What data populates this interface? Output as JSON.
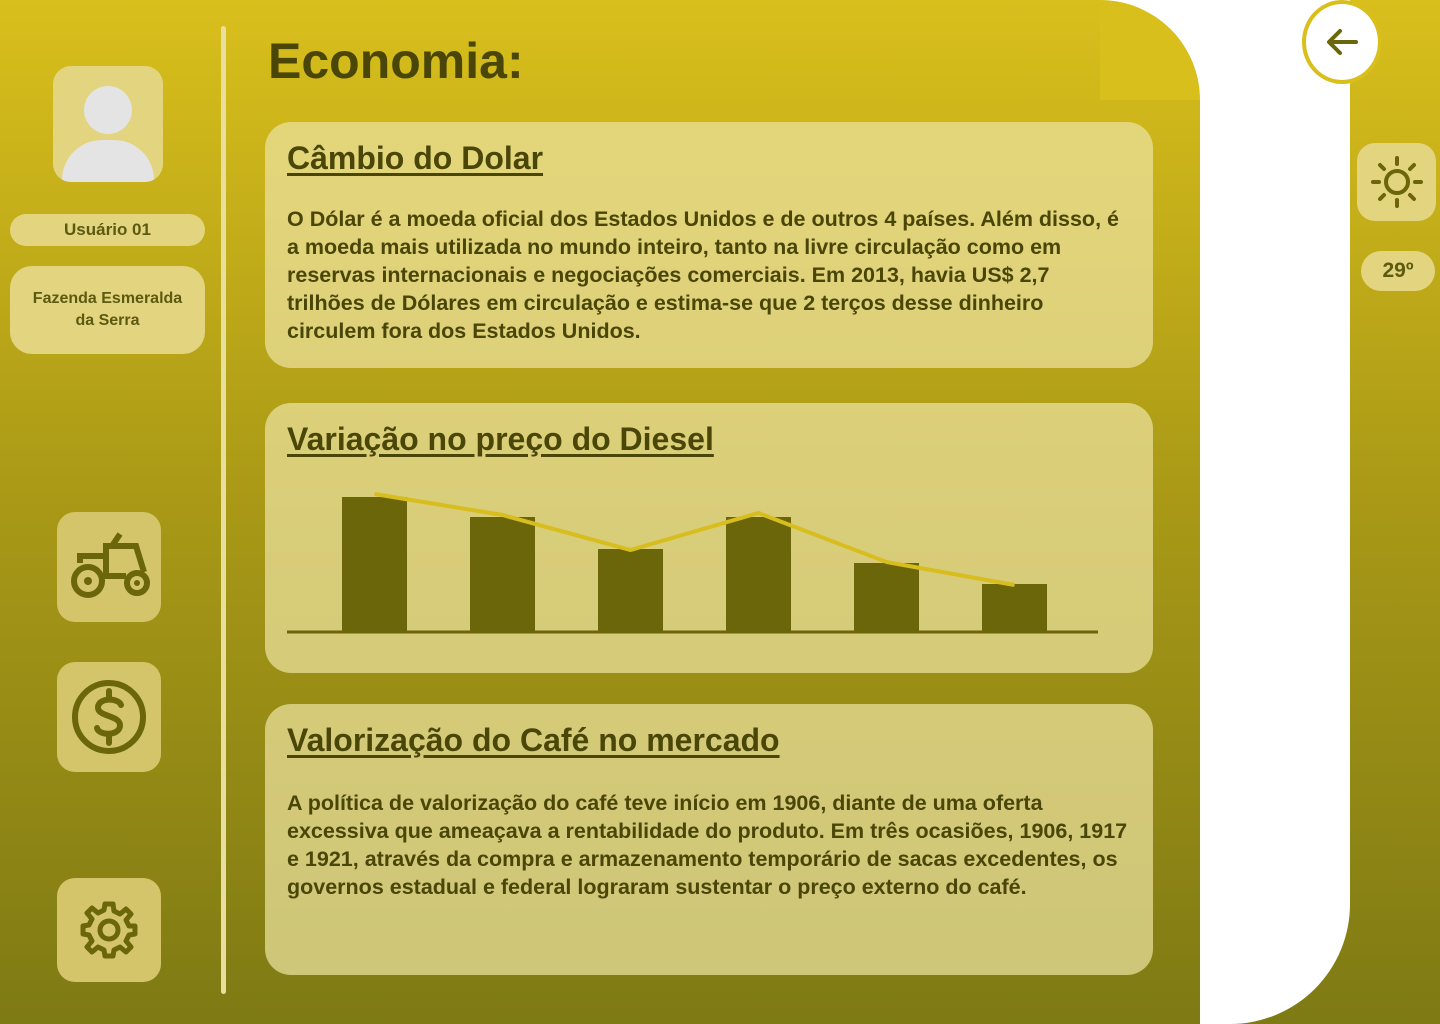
{
  "page": {
    "title": "Economia:",
    "colors": {
      "accent": "#d9bf1c",
      "text": "#4a4608",
      "bar": "#6b6609",
      "line": "#d8bd1e"
    }
  },
  "sidebar": {
    "user_label": "Usuário 01",
    "farm_label": "Fazenda Esmeralda da Serra",
    "nav": [
      {
        "icon": "tractor-icon"
      },
      {
        "icon": "dollar-icon"
      },
      {
        "icon": "gear-icon"
      }
    ]
  },
  "cards": {
    "dollar": {
      "title": "Câmbio do Dolar",
      "text": "O Dólar é a moeda oficial dos Estados Unidos e de outros 4 países. Além disso, é a moeda mais utilizada no mundo inteiro, tanto na livre circulação como em reservas internacionais e negociações comerciais. Em 2013, havia US$ 2,7 trilhões de Dólares em circulação e estima-se que 2 terços desse dinheiro circulem fora dos Estados Unidos."
    },
    "diesel": {
      "title": "Variação no preço do Diesel"
    },
    "coffee": {
      "title": "Valorização do Café no mercado",
      "text": "A política de valorização do café teve início em 1906, diante de uma oferta excessiva que ameaçava a rentabilidade do produto. Em três ocasiões, 1906, 1917 e 1921, através da compra e armazenamento temporário de sacas excedentes, os governos estadual e federal lograram sustentar o preço externo do café."
    }
  },
  "chart_data": {
    "type": "bar",
    "title": "",
    "xlabel": "",
    "ylabel": "",
    "ylim": [
      0,
      140
    ],
    "grid": false,
    "bars": [
      134,
      114,
      82,
      114,
      68,
      47
    ],
    "line": [
      137,
      116,
      81,
      118,
      69,
      46
    ]
  },
  "right_panel": {
    "back_icon": "arrow-left-icon",
    "weather_icon": "sun-icon",
    "temperature": "29º"
  }
}
